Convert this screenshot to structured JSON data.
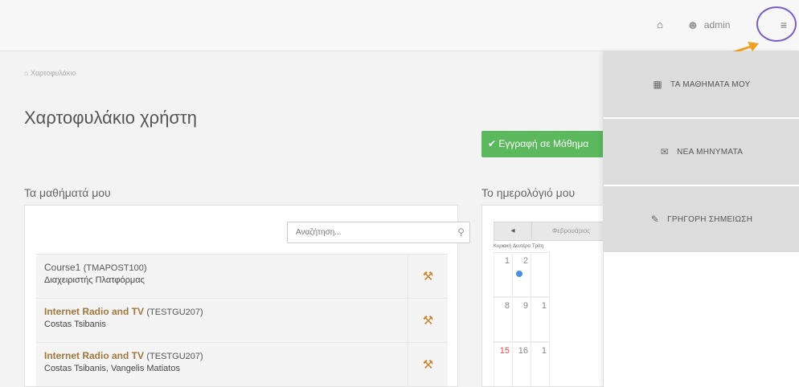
{
  "topbar": {
    "home_icon": "home-icon",
    "user_icon": "user-icon",
    "username": "admin",
    "menu_icon": "sliders-icon"
  },
  "breadcrumb": "Χαρτοφυλάκιο",
  "page_title": "Χαρτοφυλάκιο χρήστη",
  "register_button": "✔ Εγγραφή σε Μάθημα",
  "courses_section": {
    "heading": "Τα μαθήματά μου",
    "search_placeholder": "Αναζήτηση...",
    "rows": [
      {
        "title": "Course1",
        "code": "(TMAPOST100)",
        "professor": "Διαχειριστής Πλατφόρμας"
      },
      {
        "title": "Internet Radio and TV",
        "code": "(TESTGU207)",
        "professor": "Costas Tsibanis"
      },
      {
        "title": "Internet Radio and TV",
        "code": "(TESTGU207)",
        "professor": "Costas Tsibanis, Vangelis Matiatos"
      }
    ]
  },
  "calendar_section": {
    "heading": "Το ημερολόγιό μου",
    "prev_label": "◂",
    "month_label": "Φεβρουάριος",
    "day_headers": [
      "Κυριακή",
      "Δευτέρα",
      "Τρίτη"
    ],
    "weeks": [
      [
        "1",
        "2",
        ""
      ],
      [
        "8",
        "9",
        "1"
      ],
      [
        "15",
        "16",
        "1"
      ]
    ]
  },
  "dropdown": {
    "items": [
      {
        "icon": "calendar-icon",
        "label": "ΤΑ ΜΑΘΗΜΑΤΑ ΜΟΥ"
      },
      {
        "icon": "envelope-icon",
        "label": "ΝΕΑ ΜΗΝΥΜΑΤΑ"
      },
      {
        "icon": "pencil-icon",
        "label": "ΓΡΗΓΟΡΗ ΣΗΜΕΙΩΣΗ"
      }
    ]
  },
  "colors": {
    "accent_green": "#5cb85c",
    "course_title": "#a0783c",
    "annotation_circle": "#7b5cc9",
    "annotation_arrow": "#f0a020"
  }
}
